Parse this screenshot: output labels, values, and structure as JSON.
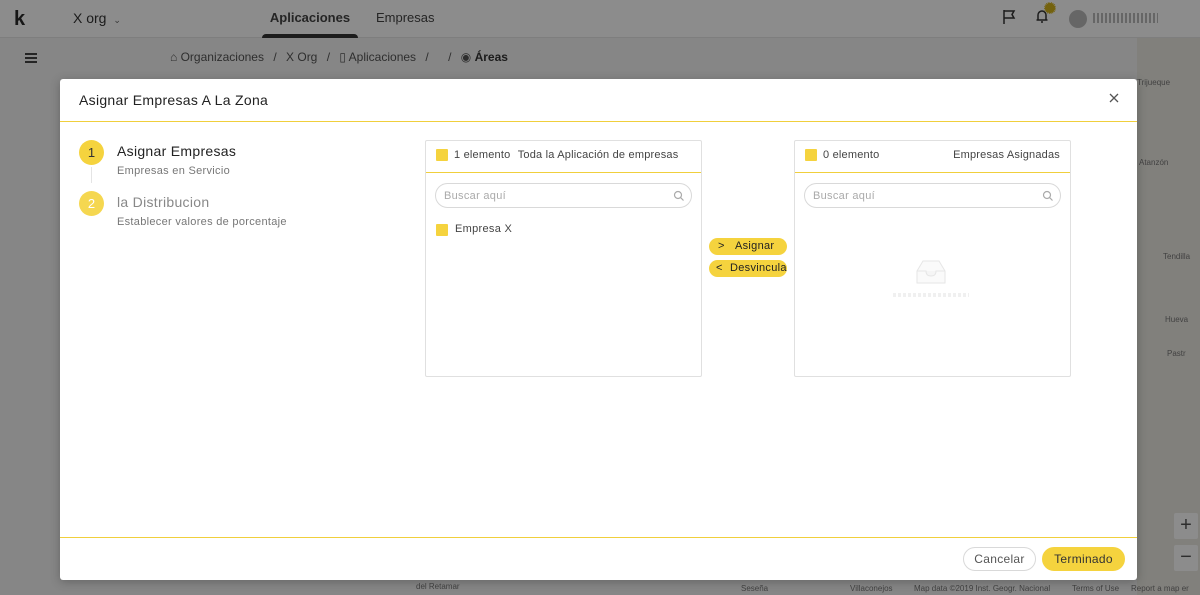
{
  "app": {
    "logo": "k",
    "org_name": "X org",
    "tabs": [
      "Aplicaciones",
      "Empresas"
    ]
  },
  "breadcrumb": {
    "items": [
      "Organizaciones",
      "X Org",
      "Aplicaciones",
      "",
      "Áreas"
    ],
    "separator": "/"
  },
  "map": {
    "labels": [
      "Trijueque",
      "Atanzón",
      "Tendilla",
      "Hueva",
      "Pastr"
    ],
    "attribution": [
      "del Retamar",
      "Seseña",
      "Villaconejos",
      "Map data ©2019 Inst. Geogr. Nacional",
      "Terms of Use",
      "Report a map er"
    ],
    "zoom_in": "+",
    "zoom_out": "−"
  },
  "modal": {
    "title": "Asignar Empresas A La Zona",
    "steps": [
      {
        "number": "1",
        "title": "Asignar Empresas",
        "description": "Empresas en Servicio"
      },
      {
        "number": "2",
        "title": "la Distribucion",
        "description": "Establecer valores de porcentaje"
      }
    ],
    "source_list": {
      "count": "1 elemento",
      "title": "Toda la Aplicación de empresas",
      "search_placeholder": "Buscar aquí",
      "items": [
        "Empresa X"
      ]
    },
    "target_list": {
      "count": "0 elemento",
      "title": "Empresas Asignadas",
      "search_placeholder": "Buscar aquí",
      "items": []
    },
    "operations": {
      "assign_icon": ">",
      "assign_label": "Asignar",
      "unlink_icon": "<",
      "unlink_label": "Desvincular"
    },
    "footer": {
      "cancel_label": "Cancelar",
      "done_label": "Terminado"
    }
  },
  "colors": {
    "accent": "#f5d33e",
    "divider": "#f0cf3c"
  }
}
